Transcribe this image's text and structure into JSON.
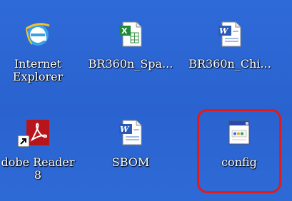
{
  "desktop": {
    "icons": [
      {
        "name": "internet-explorer",
        "label_lines": [
          "Internet",
          "Explorer"
        ],
        "icon": "internet-explorer-icon"
      },
      {
        "name": "excel-file",
        "label_lines": [
          "BR360n_Spa..."
        ],
        "icon": "excel-document-icon"
      },
      {
        "name": "word-file",
        "label_lines": [
          "BR360n_Chi..."
        ],
        "icon": "word-document-icon"
      },
      {
        "name": "adobe-reader",
        "label_lines": [
          "dobe Reader",
          "8"
        ],
        "icon": "adobe-reader-icon"
      },
      {
        "name": "sbom-file",
        "label_lines": [
          "SBOM"
        ],
        "icon": "word-document-icon"
      },
      {
        "name": "config-file",
        "label_lines": [
          "config"
        ],
        "icon": "config-file-icon"
      }
    ],
    "highlight_color": "#e21a1a",
    "background_color": "#2c66d2"
  }
}
